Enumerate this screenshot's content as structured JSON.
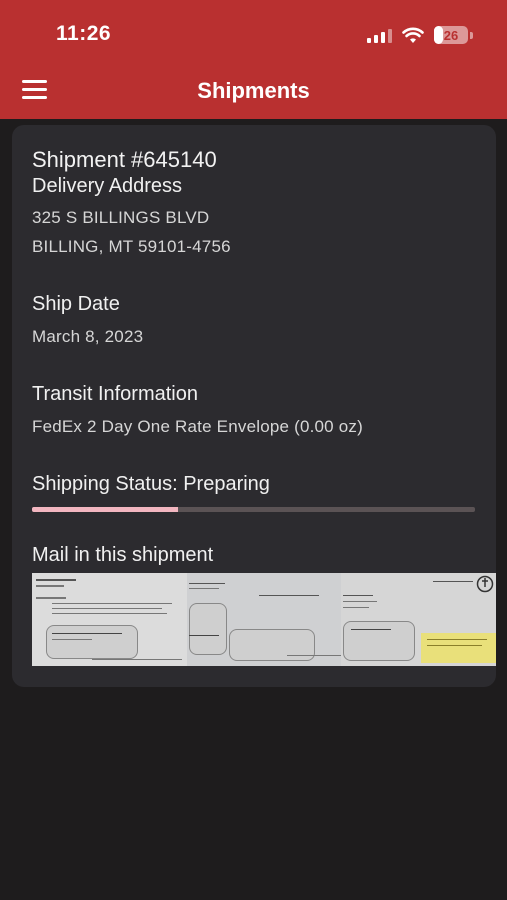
{
  "status_bar": {
    "time": "11:26",
    "battery": "26"
  },
  "nav": {
    "title": "Shipments"
  },
  "shipment": {
    "title": "Shipment #645140",
    "address_label": "Delivery Address",
    "address_line1": "325 S BILLINGS BLVD",
    "address_line2": "BILLING, MT 59101-4756",
    "ship_date_label": "Ship Date",
    "ship_date": "March 8, 2023",
    "transit_label": "Transit Information",
    "transit_value": "FedEx 2 Day One Rate Envelope (0.00 oz)",
    "status_text": "Shipping Status: Preparing",
    "status_progress": 0.33,
    "mail_label": "Mail in this shipment"
  },
  "colors": {
    "header": "#b93030",
    "background": "#1e1c1d",
    "card": "#2c2b2f",
    "progress_fill": "#f2b6c0",
    "progress_track": "#5b5355"
  },
  "mail_items": [
    {
      "name": "mail-thumbnail-1"
    },
    {
      "name": "mail-thumbnail-2"
    },
    {
      "name": "mail-thumbnail-3"
    }
  ]
}
